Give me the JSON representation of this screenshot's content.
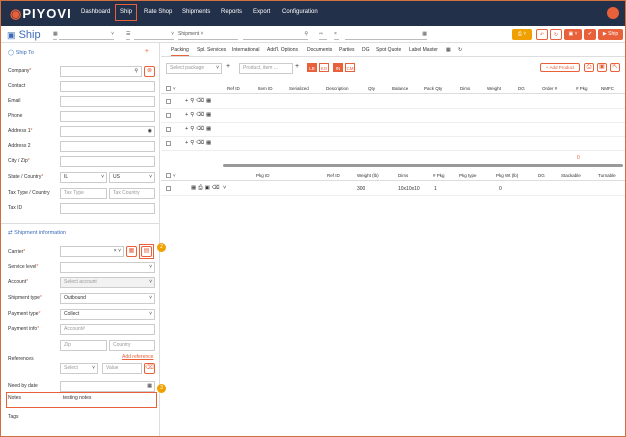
{
  "brand": {
    "name": "PIYOVI",
    "accent": "#e8613a",
    "nav_bg": "#22304a",
    "primary": "#3b6bb8"
  },
  "nav": {
    "items": [
      "Dashboard",
      "Ship",
      "Rate Shop",
      "Shipments",
      "Reports",
      "Export",
      "Configuration"
    ],
    "active": "Ship"
  },
  "toolbar": {
    "title": "Ship",
    "shipment_select": "Shipment",
    "ship_button": "Ship"
  },
  "ship_to": {
    "header": "Ship To",
    "fields": {
      "company": "Company",
      "contact": "Contact",
      "email": "Email",
      "phone": "Phone",
      "address1": "Address 1",
      "address2": "Address 2",
      "city_zip": "City / Zip",
      "state_country": "State / Country",
      "state_value": "IL",
      "country_value": "US",
      "tax_type_country": "Tax Type / Country",
      "tax_type_placeholder": "Tax Type",
      "tax_country_placeholder": "Tax Country",
      "tax_id": "Tax ID"
    }
  },
  "shipment_info": {
    "header": "Shipment information",
    "carrier": "Carrier",
    "service_level": "Service level",
    "account": "Account",
    "account_placeholder": "Select account",
    "shipment_type": "Shipment type",
    "shipment_type_value": "Outbound",
    "payment_type": "Payment type",
    "payment_type_value": "Collect",
    "payment_info": "Payment info",
    "account_num_placeholder": "Account#",
    "zip_placeholder": "Zip",
    "country_placeholder": "Country",
    "references": "References",
    "add_reference": "Add reference",
    "ref_select": "Select",
    "ref_value": "Value",
    "need_by_date": "Need by date",
    "notes": "Notes",
    "notes_value": "testing notes",
    "tags": "Tags",
    "badge_2": "2",
    "badge_3": "3"
  },
  "tabs": [
    "Packing",
    "Spl. Services",
    "International",
    "Add'l. Options",
    "Documents",
    "Parties",
    "DG",
    "Spot Quote",
    "Label Master"
  ],
  "packing": {
    "select_package": "Select package",
    "product_placeholder": "Product, item ...",
    "units": [
      "LB",
      "KG",
      "IN",
      "CM"
    ],
    "add_product": "Add Product",
    "product_columns": [
      "Ref ID",
      "Item ID",
      "Serialized",
      "Description",
      "Qty",
      "Balance",
      "Pack Qty",
      "Dims",
      "Weight",
      "DG",
      "Order #",
      "# Pkg",
      "NMFC"
    ],
    "total_pkg": "0",
    "package_columns": [
      "Pkg ID",
      "Ref ID",
      "Weight (lb)",
      "Dims",
      "# Pkg",
      "Pkg type",
      "Pkg Wt (lb)",
      "DG",
      "Stackable",
      "Turnable"
    ],
    "package_row": {
      "weight": "300",
      "dims": "10x10x10",
      "pkg": "1",
      "pkg_wt": "0"
    }
  }
}
